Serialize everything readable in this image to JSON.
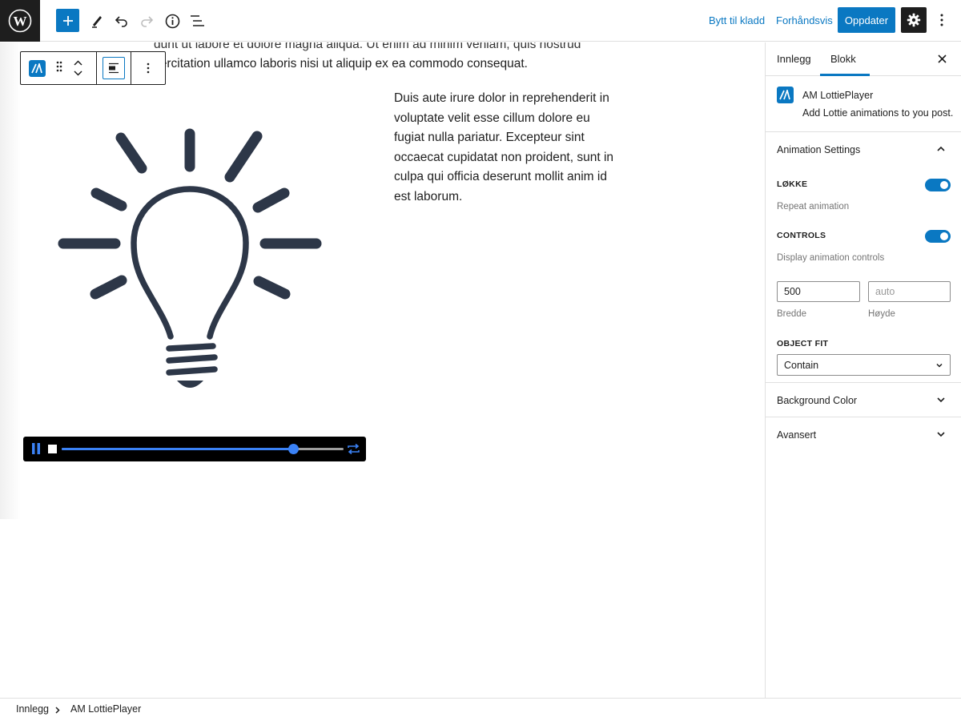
{
  "topbar": {
    "switch_to_draft": "Bytt til kladd",
    "preview": "Forhåndsvis",
    "update": "Oppdater"
  },
  "content": {
    "clipped_line": "dunt ut labore et dolore magna aliqua. Ut enim ad minim veniam, quis nostrud",
    "para_top": "xercitation ullamco laboris nisi ut aliquip ex ea commodo consequat.",
    "para_right": "Duis aute irure dolor in reprehenderit in voluptate velit esse cillum dolore eu fugiat nulla pariatur. Excepteur sint occaecat cupidatat non proident, sunt in culpa qui officia deserunt mollit anim id est laborum."
  },
  "player": {
    "progress": 0.82,
    "accent": "#3b82f6"
  },
  "sidebar": {
    "tabs": {
      "post": "Innlegg",
      "block": "Blokk"
    },
    "block": {
      "title": "AM LottiePlayer",
      "description": "Add Lottie animations to you post."
    },
    "animation_settings": {
      "title": "Animation Settings",
      "loop_label": "LØKKE",
      "loop_help": "Repeat animation",
      "loop_on": true,
      "controls_label": "CONTROLS",
      "controls_help": "Display animation controls",
      "controls_on": true,
      "width_value": "500",
      "width_label": "Bredde",
      "height_placeholder": "auto",
      "height_label": "Høyde",
      "object_fit_label": "OBJECT FIT",
      "object_fit_value": "Contain"
    },
    "background_color": "Background Color",
    "advanced": "Avansert"
  },
  "breadcrumb": {
    "items": [
      "Innlegg",
      "AM LottiePlayer"
    ]
  },
  "colors": {
    "accent": "#0a78c2",
    "dark": "#1e1e1e",
    "bulb": "#2d3748"
  }
}
